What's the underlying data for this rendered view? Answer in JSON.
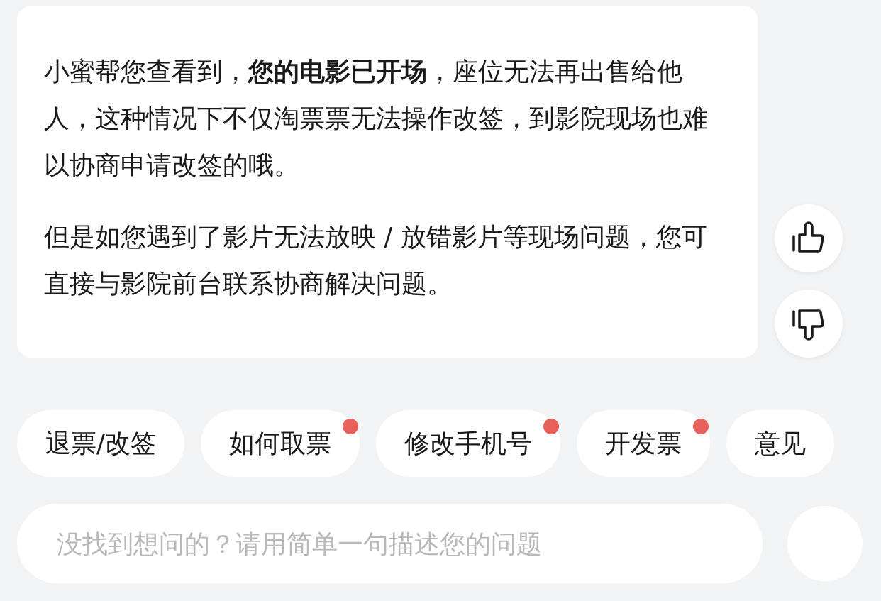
{
  "answer_card": {
    "paragraphs": [
      "小蜜帮您查看到，**您的电影已开场**，座位无法再出售给他人，这种情况下不仅淘票票无法操作改签，到影院现场也难以协商申请改签的哦。",
      "但是如您遇到了影片无法放映 / 放错影片等现场问题，您可直接与影院前台联系协商解决问题。"
    ]
  },
  "quick_replies": [
    {
      "label": "退票/改签",
      "new": false
    },
    {
      "label": "如何取票",
      "new": true
    },
    {
      "label": "修改手机号",
      "new": true
    },
    {
      "label": "开发票",
      "new": true
    },
    {
      "label": "意见",
      "new": false
    }
  ],
  "input": {
    "placeholder": "没找到想问的？请用简单一句描述您的问题"
  }
}
